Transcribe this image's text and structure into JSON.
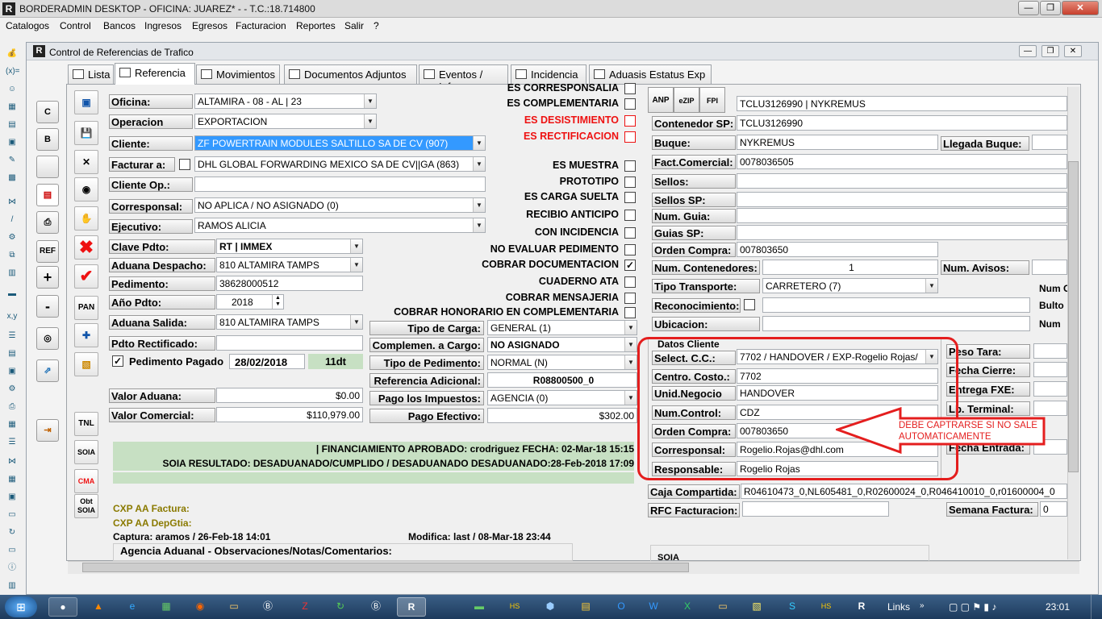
{
  "app": {
    "title": "BORDERADMIN DESKTOP - OFICINA: JUAREZ* -  - T.C.:18.714800",
    "logo": "R"
  },
  "menu": [
    "Catalogos",
    "Control",
    "Bancos",
    "Ingresos",
    "Egresos",
    "Facturacion",
    "Reportes",
    "Salir",
    "?"
  ],
  "window": {
    "title": "Control de Referencias de Trafico"
  },
  "tabs": [
    "Lista",
    "Referencia",
    "Movimientos",
    "Documentos Adjuntos",
    "Eventos / Info",
    "Incidencia",
    "Aduasis Estatus Exp"
  ],
  "side_buttons": [
    "C",
    "B",
    "",
    "TNL",
    "SOIA",
    "CMA",
    "Obt SOIA"
  ],
  "icon_buttons": {
    "ref": "REF",
    "plus": "+",
    "minus": "-",
    "pan": "PAN"
  },
  "form": {
    "oficina": {
      "label": "Oficina:",
      "value": "ALTAMIRA - 08 - AL | 23"
    },
    "operacion": {
      "label": "Operacion",
      "value": "EXPORTACION"
    },
    "cliente": {
      "label": "Cliente:",
      "value": "ZF POWERTRAIN MODULES SALTILLO SA DE CV (907)"
    },
    "facturar": {
      "label": "Facturar a:",
      "value": "DHL GLOBAL FORWARDING MEXICO SA DE CV||GA (863)"
    },
    "cliente_op": {
      "label": "Cliente Op.:",
      "value": ""
    },
    "corresponsal": {
      "label": "Corresponsal:",
      "value": "NO APLICA / NO ASIGNADO (0)"
    },
    "ejecutivo": {
      "label": "Ejecutivo:",
      "value": "RAMOS ALICIA"
    },
    "clave_pdto": {
      "label": "Clave Pdto:",
      "value": "RT | IMMEX"
    },
    "aduana_despacho": {
      "label": "Aduana Despacho:",
      "value": "810 ALTAMIRA TAMPS"
    },
    "pedimento": {
      "label": "Pedimento:",
      "value": "38628000512"
    },
    "anio_pdto": {
      "label": "Año Pdto:",
      "value": "2018"
    },
    "aduana_salida": {
      "label": "Aduana Salida:",
      "value": "810 ALTAMIRA TAMPS"
    },
    "pdto_rectificado": {
      "label": "Pdto Rectificado:",
      "value": ""
    },
    "pedimento_pagado": {
      "label": "Pedimento Pagado",
      "date": "28/02/2018",
      "days": "11dt"
    },
    "valor_aduana": {
      "label": "Valor Aduana:",
      "value": "$0.00"
    },
    "valor_comercial": {
      "label": "Valor Comercial:",
      "value": "$110,979.00"
    },
    "tipo_carga": {
      "label": "Tipo de Carga:",
      "value": "GENERAL (1)"
    },
    "complemen_cargo": {
      "label": "Complemen. a Cargo:",
      "value": "NO ASIGNADO"
    },
    "tipo_pedimento": {
      "label": "Tipo de Pedimento:",
      "value": "NORMAL (N)"
    },
    "referencia_adicional": {
      "label": "Referencia Adicional:",
      "value": "R08800500_0"
    },
    "pago_impuestos": {
      "label": "Pago los Impuestos:",
      "value": "AGENCIA (0)"
    },
    "pago_efectivo": {
      "label": "Pago Efectivo:",
      "value": "$302.00"
    }
  },
  "checks": [
    {
      "label": "ES CORRESPONSALIA",
      "checked": false
    },
    {
      "label": "ES COMPLEMENTARIA",
      "checked": false
    },
    {
      "label": "ES DESISTIMIENTO",
      "checked": false,
      "red": true
    },
    {
      "label": "ES RECTIFICACION",
      "checked": false,
      "red": true
    },
    {
      "label": "ES MUESTRA",
      "checked": false
    },
    {
      "label": "PROTOTIPO",
      "checked": false
    },
    {
      "label": "ES CARGA SUELTA",
      "checked": false
    },
    {
      "label": "RECIBIO ANTICIPO",
      "checked": false
    },
    {
      "label": "CON INCIDENCIA",
      "checked": false
    },
    {
      "label": "NO EVALUAR PEDIMENTO",
      "checked": false
    },
    {
      "label": "COBRAR DOCUMENTACION",
      "checked": true
    },
    {
      "label": "CUADERNO ATA",
      "checked": false
    },
    {
      "label": "COBRAR MENSAJERIA",
      "checked": false
    },
    {
      "label": "COBRAR HONORARIO EN COMPLEMENTARIA",
      "checked": false
    }
  ],
  "status": {
    "line1": "| FINANCIAMIENTO APROBADO: crodriguez FECHA: 02-Mar-18 15:15",
    "line2": "SOIA RESULTADO: DESADUANADO/CUMPLIDO / DESADUANADO  DESADUANADO:28-Feb-2018 17:09"
  },
  "bottom": {
    "cxp_factura": "CXP AA Factura:",
    "cxp_depgtia": "CXP AA DepGtia:",
    "captura": "Captura: aramos / 26-Feb-18 14:01",
    "modifica": "Modifica: last / 08-Mar-18 23:44",
    "observaciones": "Agencia Aduanal - Observaciones/Notas/Comentarios:"
  },
  "right": {
    "top_buttons": [
      "ANP",
      "eZIP",
      "FPI"
    ],
    "container_line": "TCLU3126990 | NYKREMUS",
    "contenedor_sp": {
      "label": "Contenedor SP:",
      "value": "TCLU3126990"
    },
    "buque": {
      "label": "Buque:",
      "value": "NYKREMUS"
    },
    "llegada_buque": {
      "label": "Llegada Buque:"
    },
    "fact_comercial": {
      "label": "Fact.Comercial:",
      "value": "0078036505"
    },
    "sellos": {
      "label": "Sellos:"
    },
    "sellos_sp": {
      "label": "Sellos SP:"
    },
    "num_guia": {
      "label": "Num. Guia:"
    },
    "guias_sp": {
      "label": "Guias SP:"
    },
    "orden_compra": {
      "label": "Orden Compra:",
      "value": "007803650"
    },
    "num_contenedores": {
      "label": "Num. Contenedores:",
      "value": "1"
    },
    "num_avisos": {
      "label": "Num. Avisos:"
    },
    "tipo_transporte": {
      "label": "Tipo Transporte:",
      "value": "CARRETERO (7)"
    },
    "reconocimiento": {
      "label": "Reconocimiento:"
    },
    "ubicacion": {
      "label": "Ubicacion:"
    },
    "num_c": "Num C",
    "bulto": "Bulto",
    "num_n": "Num"
  },
  "datos_cliente": {
    "title": "Datos Cliente",
    "select_cc": {
      "label": "Select. C.C.:",
      "value": "7702 / HANDOVER / EXP-Rogelio Rojas/"
    },
    "centro_costo": {
      "label": "Centro. Costo.:",
      "value": "7702"
    },
    "unid_negocio": {
      "label": "Unid.Negocio",
      "value": "HANDOVER"
    },
    "num_control": {
      "label": "Num.Control:",
      "value": "CDZ"
    },
    "orden_compra": {
      "label": "Orden Compra:",
      "value": "007803650"
    },
    "corresponsal": {
      "label": "Corresponsal:",
      "value": "Rogelio.Rojas@dhl.com"
    },
    "responsable": {
      "label": "Responsable:",
      "value": "Rogelio Rojas"
    }
  },
  "right_extra": {
    "peso_tara": "Peso Tara:",
    "fecha_cierre": "Fecha Cierre:",
    "entrega_fxe": "Entrega FXE:",
    "lb_terminal": "Lb. Terminal:",
    "fecha_entrada": "Fecha Entrada:"
  },
  "annotation": {
    "text": "DEBE CAPTRARSE SI NO SALE AUTOMATICAMENTE",
    "color": "#e41e1e"
  },
  "caja": {
    "label": "Caja Compartida:",
    "value": "R04610473_0,NL605481_0,R02600024_0,R046410010_0,r01600004_0"
  },
  "rfc": {
    "label": "RFC Facturacion:",
    "value": ""
  },
  "semana": {
    "label": "Semana Factura:",
    "value": "0"
  },
  "soia_label": "SOIA",
  "taskbar": {
    "links": "Links",
    "time": "23:01"
  }
}
